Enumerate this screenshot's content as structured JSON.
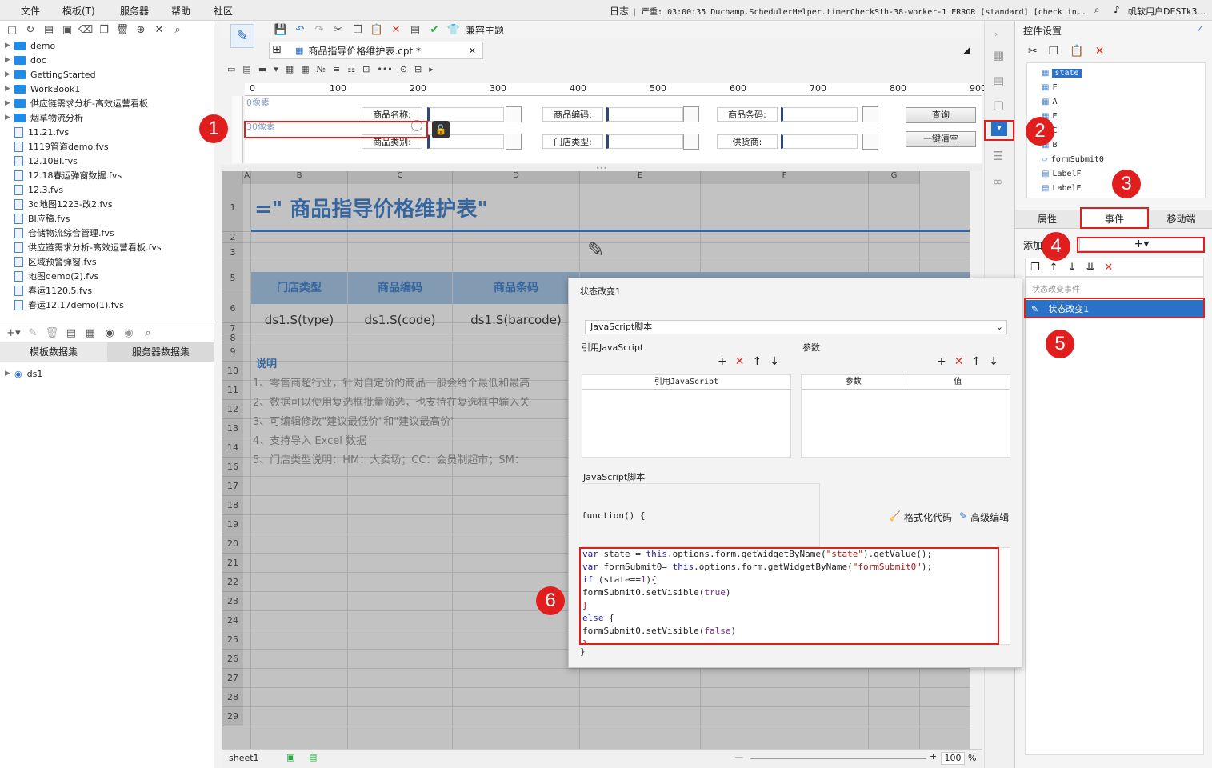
{
  "menu": {
    "file": "文件",
    "template": "模板(T)",
    "server": "服务器",
    "help": "帮助",
    "community": "社区"
  },
  "status": {
    "log": "日志",
    "message": "| 严重: 03:00:35 Duchamp.SchedulerHelper.timerCheckSth-38-worker-1 ERROR [standard] [check in...",
    "user": "帆软用户DESTk3..."
  },
  "left": {
    "tree": [
      "demo",
      "doc",
      "GettingStarted",
      "WorkBook1",
      "供应链需求分析-高效运营看板",
      "烟草物流分析",
      "11.21.fvs",
      "1119管道demo.fvs",
      "12.10BI.fvs",
      "12.18春运弹窗数据.fvs",
      "12.3.fvs",
      "3d地图1223-改2.fvs",
      "BI应稿.fvs",
      "仓储物流综合管理.fvs",
      "供应链需求分析-高效运营看板.fvs",
      "区域预警弹窗.fvs",
      "地图demo(2).fvs",
      "春运1120.5.fvs",
      "春运12.17demo(1).fvs"
    ],
    "tabs": {
      "template_ds": "模板数据集",
      "server_ds": "服务器数据集"
    },
    "dataset": "ds1"
  },
  "toolbar": {
    "compat": "兼容主题"
  },
  "doc_tab": {
    "title": "商品指导价格维护表.cpt *"
  },
  "ruler": [
    "0",
    "100",
    "200",
    "300",
    "400",
    "500",
    "600",
    "700",
    "800",
    "900"
  ],
  "form": {
    "px0": "0像素",
    "px30": "30像素",
    "label_name": "商品名称:",
    "label_code": "商品编码:",
    "label_barcode": "商品条码:",
    "label_category": "商品类别:",
    "label_store": "门店类型:",
    "label_supplier": "供货商:",
    "btn_query": "查询",
    "btn_clear": "一键清空"
  },
  "sheet": {
    "cols": [
      "A",
      "B",
      "C",
      "D",
      "E",
      "F",
      "G"
    ],
    "title": "=\"  商品指导价格维护表\"",
    "headers": [
      "门店类型",
      "商品编码",
      "商品条码"
    ],
    "fields": [
      "ds1.S(type)",
      "ds1.S(code)",
      "ds1.S(barcode)"
    ],
    "note_title": "说明",
    "notes": [
      "1、零售商超行业，针对自定价的商品一般会给个最低和最高",
      "2、数据可以使用复选框批量筛选，也支持在复选框中输入关",
      "3、可编辑修改\"建议最低价\"和\"建议最高价\"",
      "4、支持导入 Excel 数据",
      "5、门店类型说明：HM：大卖场；CC：会员制超市；SM："
    ],
    "rows": [
      "1",
      "2",
      "3",
      "5",
      "6",
      "7",
      "8",
      "9",
      "10",
      "11",
      "12",
      "13",
      "14",
      "16",
      "17",
      "18",
      "19",
      "20",
      "21",
      "22",
      "23",
      "24",
      "25",
      "26",
      "27",
      "28",
      "29"
    ],
    "sheet_tab": "sheet1",
    "zoom": "100",
    "zoom_unit": "%"
  },
  "right": {
    "title": "控件设置",
    "widgets": [
      "state",
      "F",
      "A",
      "E",
      "C",
      "B",
      "formSubmit0",
      "LabelF",
      "LabelE"
    ],
    "tabs": {
      "props": "属性",
      "events": "事件",
      "mobile": "移动端"
    },
    "add_label": "添加",
    "event_group": "状态改变事件",
    "event_item": "状态改变1"
  },
  "dialog": {
    "title": "状态改变1",
    "type": "JavaScript脚本",
    "ref_js": "引用JavaScript",
    "params": "参数",
    "col_ref": "引用JavaScript",
    "col_param": "参数",
    "col_value": "值",
    "script_label": "JavaScript脚本",
    "func_open": "function() {",
    "format": "格式化代码",
    "adv_edit": "高级编辑",
    "func_close": "}"
  },
  "badges": [
    "1",
    "2",
    "3",
    "4",
    "5",
    "6"
  ],
  "colors": {
    "accent": "#2a72c8",
    "annotation": "#e01e1e",
    "header_bg": "#9ec3e6"
  }
}
